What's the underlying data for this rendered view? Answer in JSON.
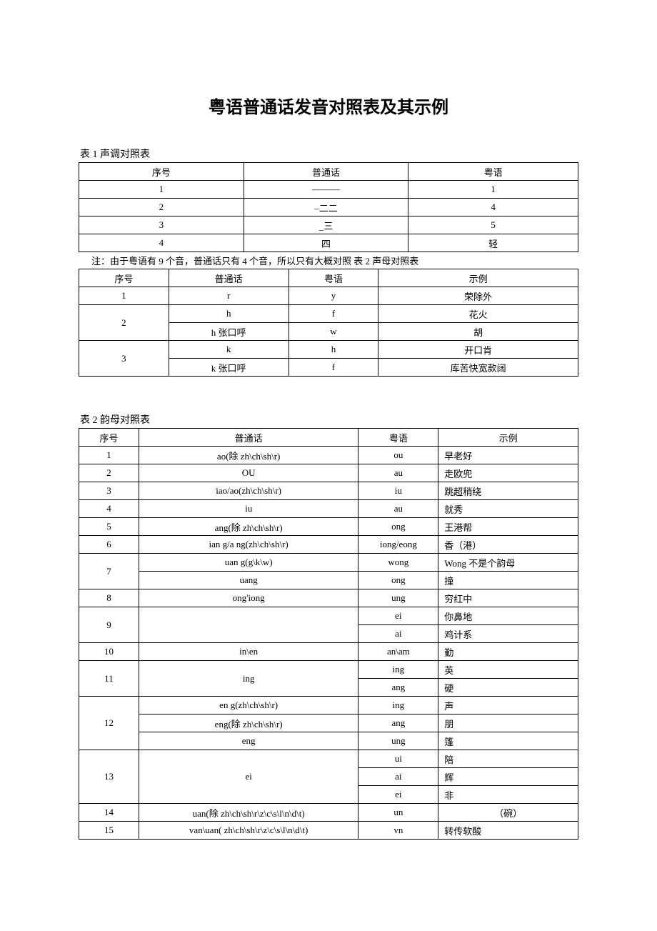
{
  "title": "粤语普通话发音对照表及其示例",
  "table1": {
    "caption": "表 1 声调对照表",
    "headers": [
      "序号",
      "普通话",
      "粤语"
    ],
    "rows": [
      [
        "1",
        "———",
        "1"
      ],
      [
        "2",
        "–二二",
        "4"
      ],
      [
        "3",
        "_三",
        "5"
      ],
      [
        "4",
        "四",
        "轻"
      ]
    ]
  },
  "note_text": "注：由于粤语有 9 个音，普通话只有  4 个音，所以只有大概对照  表 2 声母对照表",
  "table2": {
    "headers": [
      "序号",
      "普通话",
      "粤语",
      "示例"
    ],
    "rows": [
      {
        "seq": "1",
        "rowspan": 1,
        "cells": [
          [
            "r",
            "y",
            "荣除外"
          ]
        ]
      },
      {
        "seq": "2",
        "rowspan": 2,
        "cells": [
          [
            "h",
            "f",
            "花火"
          ],
          [
            "h 张口呼",
            "w",
            "胡"
          ]
        ]
      },
      {
        "seq": "3",
        "rowspan": 2,
        "cells": [
          [
            "k",
            "h",
            "开口肯"
          ],
          [
            "k 张口呼",
            "f",
            "库苦快宽款阔"
          ]
        ]
      }
    ]
  },
  "table3": {
    "caption": "表 2 韵母对照表",
    "headers": [
      "序号",
      "普通话",
      "粤语",
      "示例"
    ],
    "rows": [
      {
        "seq": "1",
        "span": 1,
        "p": [
          "ao(除  zh\\ch\\sh\\r)"
        ],
        "y": [
          "ou"
        ],
        "ex": [
          "早老好"
        ]
      },
      {
        "seq": "2",
        "span": 1,
        "p": [
          "OU"
        ],
        "y": [
          "au"
        ],
        "ex": [
          "走欧兜"
        ]
      },
      {
        "seq": "3",
        "span": 1,
        "p": [
          "iao/ao(zh\\ch\\sh\\r)"
        ],
        "y": [
          "iu"
        ],
        "ex": [
          "跳超稍绕"
        ]
      },
      {
        "seq": "4",
        "span": 1,
        "p": [
          "iu"
        ],
        "y": [
          "au"
        ],
        "ex": [
          "就秀"
        ]
      },
      {
        "seq": "5",
        "span": 1,
        "p": [
          "ang(除  zh\\ch\\sh\\r)"
        ],
        "y": [
          "ong"
        ],
        "ex": [
          "王港帮"
        ]
      },
      {
        "seq": "6",
        "span": 1,
        "p": [
          "ian g/a ng(zh\\ch\\sh\\r)"
        ],
        "y": [
          "iong/eong"
        ],
        "ex": [
          "香（港）"
        ]
      },
      {
        "seq": "7",
        "span": 2,
        "p": [
          "uan g(g\\k\\w)",
          "uang"
        ],
        "y": [
          "wong",
          "ong"
        ],
        "ex": [
          "Wong 不是个韵母",
          "撞"
        ]
      },
      {
        "seq": "8",
        "span": 1,
        "p": [
          "ong'iong"
        ],
        "y": [
          "ung"
        ],
        "ex": [
          "穷红中"
        ]
      },
      {
        "seq": "9",
        "span": 2,
        "p_merged": "",
        "y": [
          "ei",
          "ai"
        ],
        "ex": [
          "你鼻地",
          "鸡计系"
        ]
      },
      {
        "seq": "10",
        "span": 1,
        "p": [
          "in\\en"
        ],
        "y": [
          "an\\am"
        ],
        "ex": [
          "勤"
        ]
      },
      {
        "seq": "11",
        "span": 2,
        "p_merged": "ing",
        "y": [
          "ing",
          "ang"
        ],
        "ex": [
          "英",
          "硬"
        ]
      },
      {
        "seq": "12",
        "span": 3,
        "p": [
          "en g(zh\\ch\\sh\\r)",
          "eng(除  zh\\ch\\sh\\r)",
          "eng"
        ],
        "y": [
          "ing",
          "ang",
          "ung"
        ],
        "ex": [
          "声",
          "朋",
          "篷"
        ]
      },
      {
        "seq": "13",
        "span": 3,
        "p_merged": "ei",
        "y": [
          "ui",
          "ai",
          "ei"
        ],
        "ex": [
          "陪",
          "辉",
          "非"
        ]
      },
      {
        "seq": "14",
        "span": 1,
        "p": [
          "uan(除  zh\\ch\\sh\\r\\z\\c\\s\\l\\n\\d\\t)"
        ],
        "y": [
          "un"
        ],
        "ex": [
          "（碗）"
        ]
      },
      {
        "seq": "15",
        "span": 1,
        "p": [
          "van\\uan( zh\\ch\\sh\\r\\z\\c\\s\\l\\n\\d\\t)"
        ],
        "y": [
          "vn"
        ],
        "ex": [
          "转传软酸"
        ]
      }
    ]
  }
}
